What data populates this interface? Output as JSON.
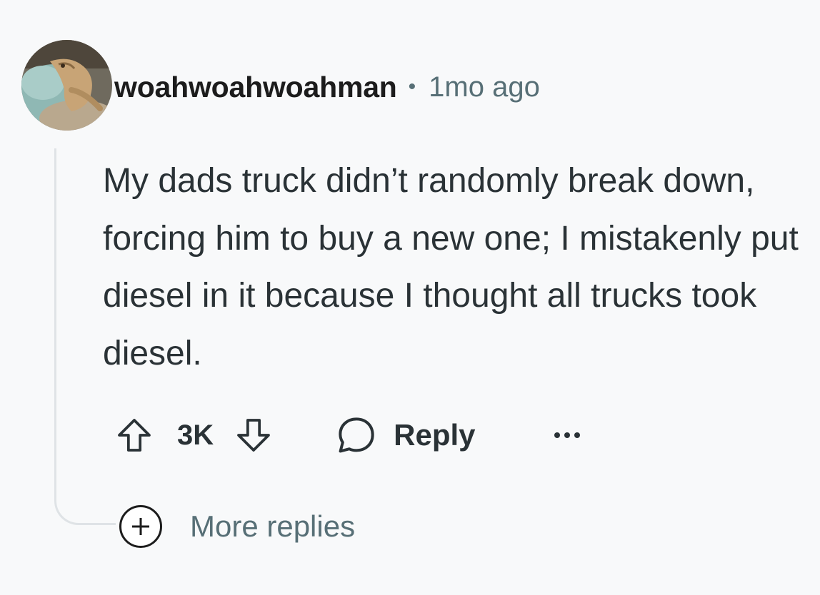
{
  "comment": {
    "username": "woahwoahwoahman",
    "separator": "•",
    "timestamp": "1mo ago",
    "body": "My dads truck didn’t randomly break down, forcing him to buy a new one; I mistakenly put diesel in it because I thought all trucks took diesel.",
    "score": "3K",
    "reply_label": "Reply",
    "more_replies_label": "More replies"
  },
  "icons": {
    "upvote": "arrow-up-outline-icon",
    "downvote": "arrow-down-outline-icon",
    "reply": "speech-bubble-icon",
    "overflow": "ellipsis-icon",
    "expand": "plus-circle-icon"
  },
  "colors": {
    "background": "#f8f9fa",
    "text_primary": "#1c1c1c",
    "text_body": "#2a3236",
    "text_secondary": "#576f76",
    "thread_line": "#dfe3e6"
  }
}
